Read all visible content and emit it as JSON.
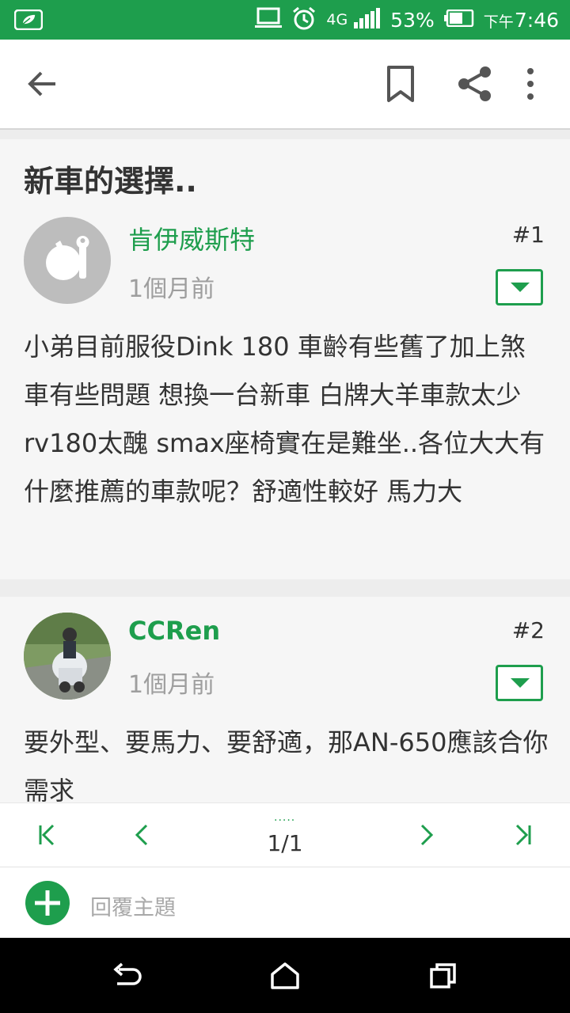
{
  "status_bar": {
    "network": "4G",
    "battery": "53%",
    "time_prefix": "下午",
    "time": "7:46",
    "icons": [
      "leaf-notification-icon",
      "laptop-icon",
      "alarm-icon",
      "signal-icon",
      "battery-icon"
    ]
  },
  "toolbar": {
    "icons": [
      "back-arrow-icon",
      "bookmark-icon",
      "share-icon",
      "more-vert-icon"
    ]
  },
  "thread": {
    "title": "新車的選擇..",
    "posts": [
      {
        "username": "肯伊威斯特",
        "time": "1個月前",
        "floor": "#1",
        "body": "小弟目前服役Dink 180 車齡有些舊了加上煞車有些問題 想換一台新車 白牌大羊車款太少rv180太醜 smax座椅實在是難坐..各位大大有什麼推薦的車款呢？舒適性較好 馬力大"
      },
      {
        "username": "CCRen",
        "time": "1個月前",
        "floor": "#2",
        "body": "要外型、要馬力、要舒適，那AN-650應該合你需求"
      }
    ]
  },
  "pager": {
    "page": "1/1",
    "dots": "....."
  },
  "reply": {
    "placeholder": "回覆主題"
  },
  "colors": {
    "accent": "#1e9e4d",
    "text": "#333333",
    "muted": "#9e9e9e"
  }
}
